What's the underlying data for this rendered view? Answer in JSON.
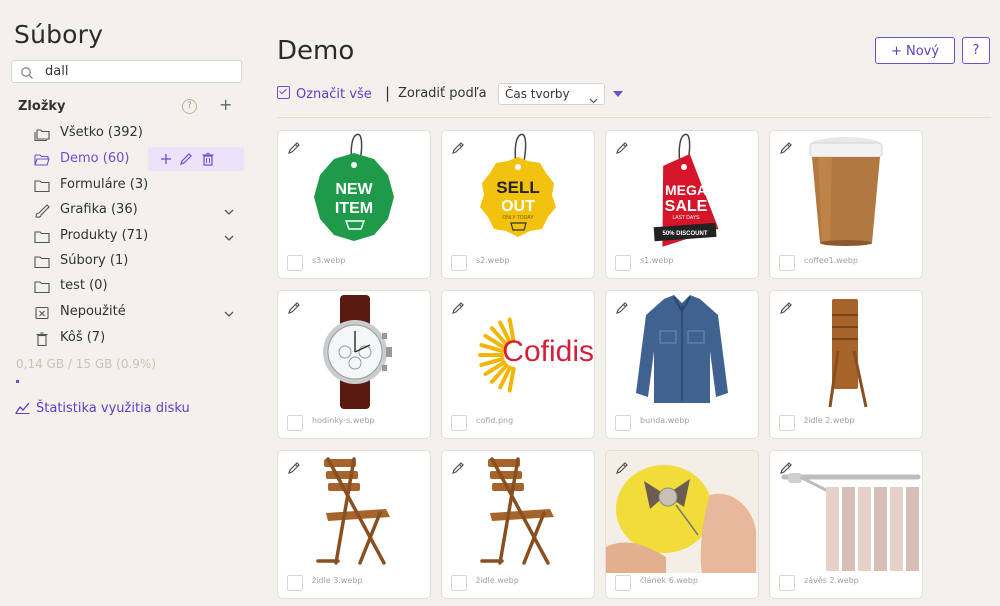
{
  "app_title": "Súbory",
  "search": {
    "value": "dall",
    "placeholder": ""
  },
  "folders_label": "Zložky",
  "help_symbol": "?",
  "add_symbol": "+",
  "folders": [
    {
      "label": "Všetko (392)",
      "icon": "folders-icon"
    },
    {
      "label": "Demo (60)",
      "icon": "folder-open-icon",
      "active": true
    },
    {
      "label": "Formuláre (3)",
      "icon": "folder-icon"
    },
    {
      "label": "Grafika (36)",
      "icon": "brush-icon",
      "expandable": true
    },
    {
      "label": "Produkty (71)",
      "icon": "folder-icon",
      "expandable": true
    },
    {
      "label": "Súbory (1)",
      "icon": "folder-icon"
    },
    {
      "label": "test (0)",
      "icon": "folder-icon"
    },
    {
      "label": "Nepoužité",
      "icon": "unused-icon",
      "expandable": true
    },
    {
      "label": "Kôš (7)",
      "icon": "trash-icon"
    }
  ],
  "usage_text": "0,14 GB / 15 GB (0.9%)",
  "usage_fraction": 0.009,
  "stats_link": "Štatistika využitia disku",
  "page_title": "Demo",
  "new_button": "+ Nový",
  "help_button": "?",
  "select_all": "Označit vše",
  "separator": "|",
  "sort_label": "Zoradiť podľa",
  "sort_value": "Čas tvorby",
  "accent": "#6b4fd1",
  "files": [
    {
      "name": "s3.webp",
      "thumb": "tag-new",
      "line1": "NEW",
      "line2": "ITEM"
    },
    {
      "name": "s2.webp",
      "thumb": "tag-sell",
      "line1": "SELL",
      "line2": "OUT",
      "line3": "ONLY TODAY"
    },
    {
      "name": "s1.webp",
      "thumb": "tag-mega",
      "line1": "MEGA",
      "line2": "SALE",
      "line3": "LAST DAYS",
      "line4": "50% DISCOUNT"
    },
    {
      "name": "coffee1.webp",
      "thumb": "coffee"
    },
    {
      "name": "hodinky-s.webp",
      "thumb": "watch"
    },
    {
      "name": "cofid.png",
      "thumb": "cofidis",
      "line1": "Cofidis"
    },
    {
      "name": "bunda.webp",
      "thumb": "jacket"
    },
    {
      "name": "židle 2.webp",
      "thumb": "chair-folded"
    },
    {
      "name": "židle 3.webp",
      "thumb": "chair"
    },
    {
      "name": "židle.webp",
      "thumb": "chair"
    },
    {
      "name": "článek 6.webp",
      "thumb": "button-felt"
    },
    {
      "name": "závěs 2.webp",
      "thumb": "curtain"
    }
  ]
}
